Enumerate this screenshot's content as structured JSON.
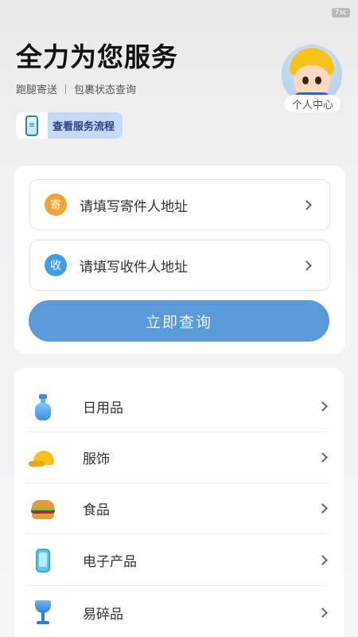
{
  "status": {
    "timer": "7sc"
  },
  "header": {
    "title": "全力为您服务",
    "subtitle_left": "跑腿寄送",
    "subtitle_right": "包裹状态查询",
    "process_button": "查看服务流程"
  },
  "profile": {
    "label": "个人中心"
  },
  "address_card": {
    "sender": {
      "badge": "寄",
      "placeholder": "请填写寄件人地址",
      "badge_color": "#f3a23a"
    },
    "receiver": {
      "badge": "收",
      "placeholder": "请填写收件人地址",
      "badge_color": "#3f9ee6"
    },
    "query_button": "立即查询",
    "button_color": "#5b9ad8"
  },
  "categories": [
    {
      "label": "日用品",
      "icon": "soap-bottle-icon"
    },
    {
      "label": "服饰",
      "icon": "cap-icon"
    },
    {
      "label": "食品",
      "icon": "burger-icon"
    },
    {
      "label": "电子产品",
      "icon": "phone-icon"
    },
    {
      "label": "易碎品",
      "icon": "wine-glass-icon"
    }
  ]
}
